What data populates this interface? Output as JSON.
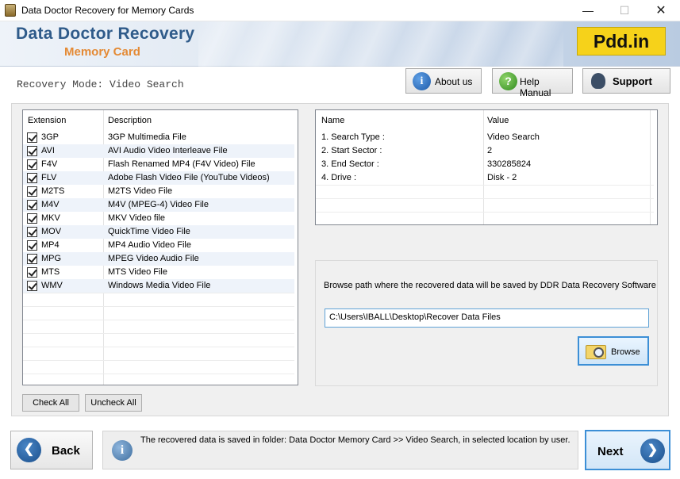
{
  "window": {
    "title": "Data Doctor Recovery for Memory Cards",
    "controls": {
      "minimize": "—",
      "maximize": "☐",
      "close": "✕"
    }
  },
  "header": {
    "brand_title": "Data Doctor Recovery",
    "brand_subtitle": "Memory Card",
    "logo_text": "Pdd.in",
    "mode": "Recovery Mode: Video Search",
    "buttons": {
      "about": "About us",
      "help": "Help Manual",
      "support": "Support"
    }
  },
  "extensions": {
    "columns": {
      "extension": "Extension",
      "description": "Description"
    },
    "rows": [
      {
        "ext": "3GP",
        "desc": "3GP Multimedia File",
        "checked": true
      },
      {
        "ext": "AVI",
        "desc": "AVI Audio Video Interleave File",
        "checked": true
      },
      {
        "ext": "F4V",
        "desc": "Flash Renamed MP4 (F4V Video) File",
        "checked": true
      },
      {
        "ext": "FLV",
        "desc": "Adobe Flash Video File (YouTube Videos)",
        "checked": true
      },
      {
        "ext": "M2TS",
        "desc": "M2TS Video File",
        "checked": true
      },
      {
        "ext": "M4V",
        "desc": "M4V (MPEG-4) Video File",
        "checked": true
      },
      {
        "ext": "MKV",
        "desc": "MKV Video file",
        "checked": true
      },
      {
        "ext": "MOV",
        "desc": "QuickTime Video File",
        "checked": true
      },
      {
        "ext": "MP4",
        "desc": "MP4 Audio Video File",
        "checked": true
      },
      {
        "ext": "MPG",
        "desc": "MPEG Video Audio File",
        "checked": true
      },
      {
        "ext": "MTS",
        "desc": "MTS Video File",
        "checked": true
      },
      {
        "ext": "WMV",
        "desc": "Windows Media Video File",
        "checked": true
      }
    ],
    "check_all": "Check All",
    "uncheck_all": "Uncheck All"
  },
  "info": {
    "columns": {
      "name": "Name",
      "value": "Value"
    },
    "rows": [
      {
        "name": "1. Search Type :",
        "value": "Video Search"
      },
      {
        "name": "2. Start Sector :",
        "value": "2"
      },
      {
        "name": "3. End Sector :",
        "value": "330285824"
      },
      {
        "name": "4. Drive :",
        "value": "Disk - 2"
      }
    ]
  },
  "browse": {
    "prompt": "Browse path where the recovered data will be saved by DDR Data Recovery Software",
    "path": "C:\\Users\\IBALL\\Desktop\\Recover Data Files",
    "button": "Browse"
  },
  "footer": {
    "back": "Back",
    "next": "Next",
    "status": "The recovered data is saved in folder: Data Doctor Memory Card  >> Video Search, in selected location by user."
  }
}
